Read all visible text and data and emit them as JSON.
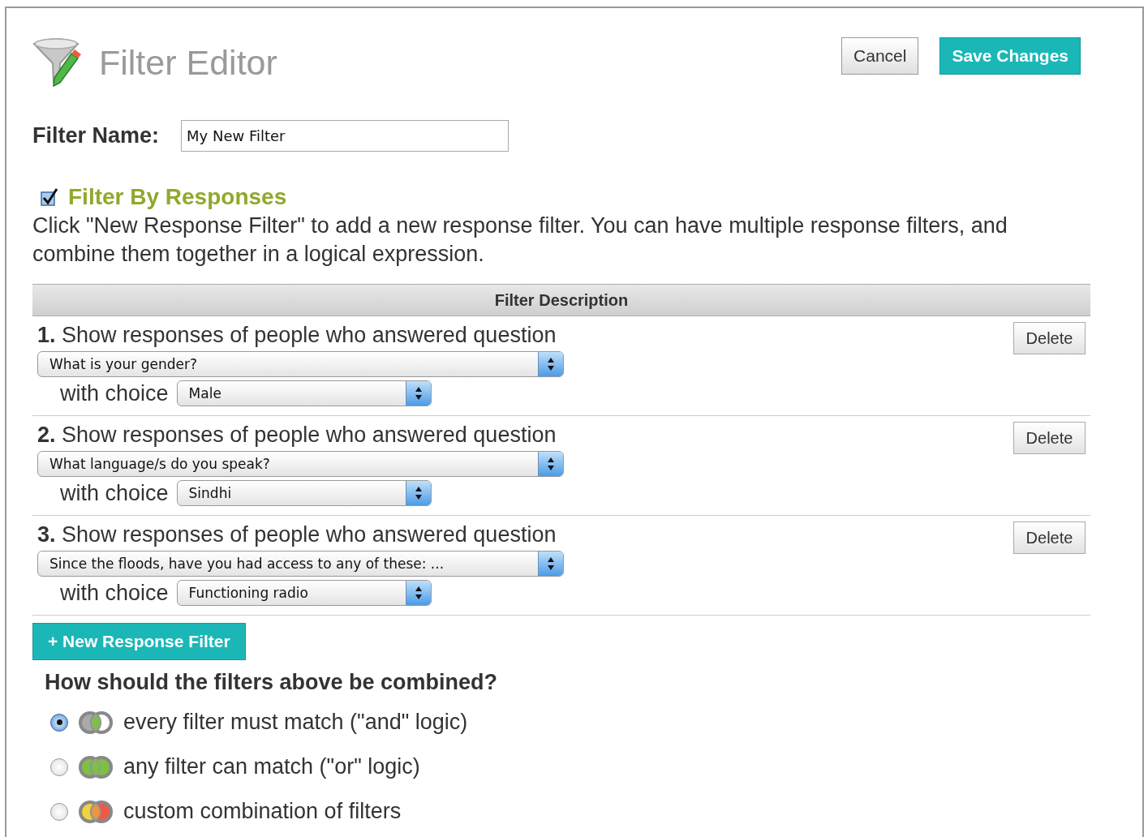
{
  "header": {
    "title": "Filter Editor",
    "buttons": [
      {
        "label": "Cancel",
        "kind": "secondary"
      },
      {
        "label": "Save Changes",
        "kind": "primary"
      }
    ]
  },
  "filter_name": {
    "label": "Filter Name:",
    "value": "My New Filter"
  },
  "filter_by_responses": {
    "label": "Filter By Responses",
    "checked": true,
    "description": "Click \"New Response Filter\" to add a new response filter. You can have multiple response filters, and combine them together in a logical expression."
  },
  "table": {
    "header": "Filter Description",
    "rows": [
      {
        "text": "**1.** Show responses of people who answered question",
        "question": "What is your gender?",
        "choice_label": "with choice",
        "choice": "Male",
        "delete": "Delete"
      },
      {
        "text": "**2.** Show responses of people who answered question",
        "question": "What language/s do you speak?",
        "choice_label": "with choice",
        "choice": "Sindhi",
        "delete": "Delete"
      },
      {
        "text": "**3.** Show responses of people who answered question",
        "question": "Since the floods, have you had access to any of these: ...",
        "choice_label": "with choice",
        "choice": "Functioning radio",
        "delete": "Delete"
      }
    ]
  },
  "new_filter_button": "+ New Response Filter",
  "combine": {
    "question": "How should the filters above be combined?",
    "options": [
      {
        "label": "every filter must match (\"and\" logic)",
        "selected": true,
        "kind": "and"
      },
      {
        "label": "any filter can match (\"or\" logic)",
        "selected": false,
        "kind": "or"
      },
      {
        "label": "custom combination of filters",
        "selected": false,
        "kind": "custom"
      }
    ]
  }
}
